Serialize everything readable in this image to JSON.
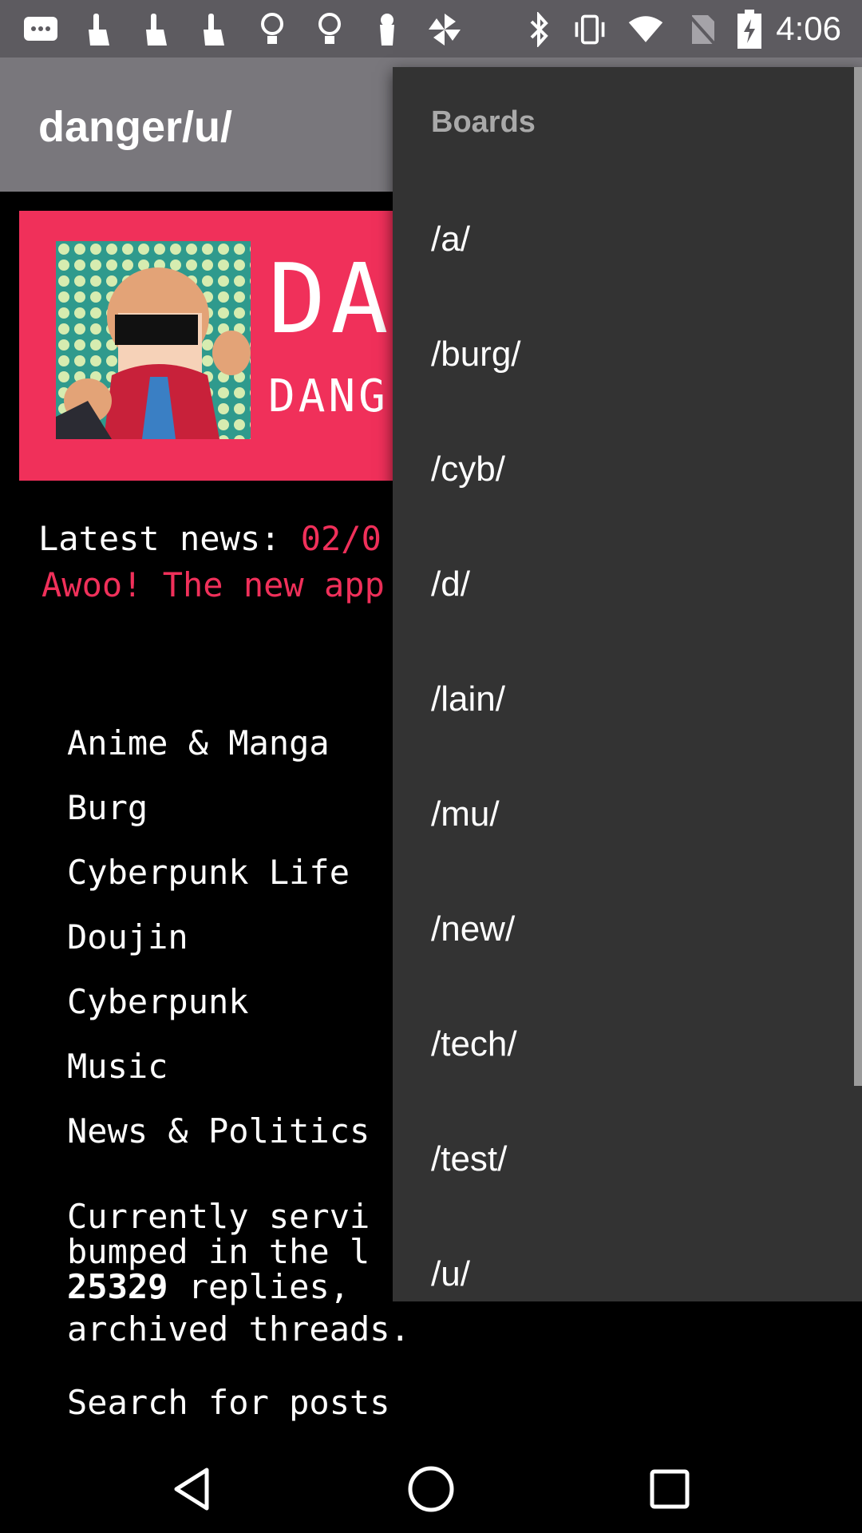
{
  "status_bar": {
    "icons": [
      "message-icon",
      "gesture-icon",
      "gesture-icon",
      "gesture-icon",
      "bulb-icon",
      "bulb-icon",
      "lamp-icon",
      "pinwheel-icon",
      "bluetooth-icon",
      "vibrate-icon",
      "wifi-icon",
      "no-sim-icon",
      "battery-charging-icon"
    ],
    "time": "4:06"
  },
  "app_bar": {
    "title": "danger/u/"
  },
  "banner": {
    "big_text": "DA",
    "small_text": "DANG"
  },
  "news": {
    "label": "Latest news:",
    "date": "02/0",
    "message": "Awoo! The new app"
  },
  "boards": [
    "Anime & Manga",
    "Burg",
    "Cyberpunk Life",
    "Doujin",
    "Cyberpunk",
    "Music",
    "News & Politics"
  ],
  "stats": {
    "line1": "Currently servi",
    "line2": "bumped in the l",
    "replies_count": "25329",
    "replies_text": " replies,",
    "line4": "archived threads."
  },
  "search_link": "Search for posts",
  "dropdown": {
    "header": "Boards",
    "items": [
      "/a/",
      "/burg/",
      "/cyb/",
      "/d/",
      "/lain/",
      "/mu/",
      "/new/",
      "/tech/",
      "/test/",
      "/u/"
    ]
  },
  "nav_bar": {
    "icons": [
      "back-icon",
      "home-icon",
      "recents-icon"
    ]
  }
}
